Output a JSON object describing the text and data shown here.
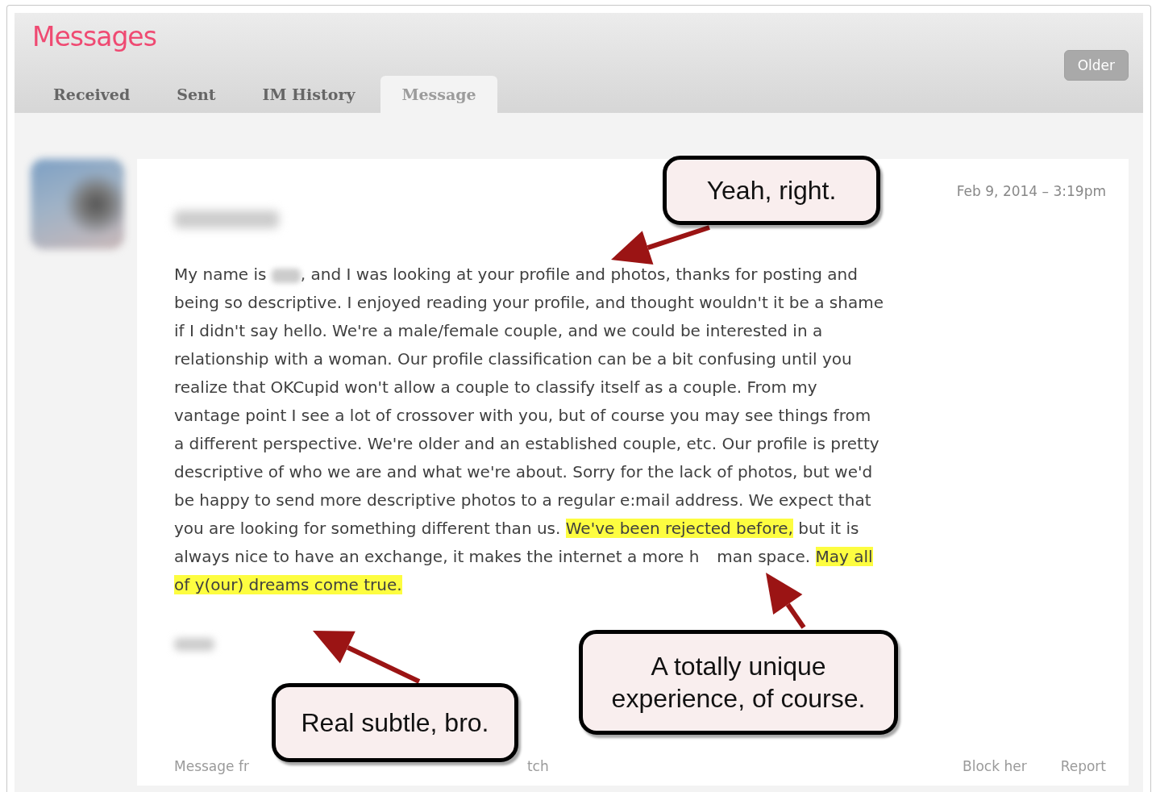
{
  "header": {
    "title": "Messages",
    "older_button": "Older"
  },
  "tabs": [
    {
      "label": "Received",
      "selected": false
    },
    {
      "label": "Sent",
      "selected": false
    },
    {
      "label": "IM History",
      "selected": false
    },
    {
      "label": "Message",
      "selected": true
    }
  ],
  "message": {
    "date": "Feb 9, 2014 – 3:19pm",
    "body": [
      {
        "kind": "text",
        "text": "My name is ",
        "highlighted": false
      },
      {
        "kind": "redacted"
      },
      {
        "kind": "text",
        "text": ", and I was looking at your profile and photos, thanks for posting and being so descriptive. I enjoyed reading your profile, and thought wouldn't it be a shame if I didn't say hello. We're a male/female couple, and we could be interested in a relationship with a woman. Our profile classification can be a bit confusing until you realize that OKCupid won't allow a couple to classify itself as a couple. From my vantage point I see a lot of crossover with you, but of course you may see things from a different perspective. We're older and an established couple, etc. Our profile is pretty descriptive of who we are and what we're about. Sorry for the lack of photos, but we'd be happy to send more descriptive photos to a regular e:mail address. We expect that you are looking for something different than us. ",
        "highlighted": false
      },
      {
        "kind": "text",
        "text": "We've been rejected before,",
        "highlighted": true
      },
      {
        "kind": "text",
        "text": " but it is always nice to have an exchange, it makes the internet a more h",
        "highlighted": false
      },
      {
        "kind": "gap"
      },
      {
        "kind": "text",
        "text": "man space. ",
        "highlighted": false
      },
      {
        "kind": "text",
        "text": "May all of y(our) dreams come true. ",
        "highlighted": true
      }
    ],
    "footer_left": [
      "Message fr",
      "tch"
    ],
    "actions": [
      "Block her",
      "Report"
    ]
  },
  "callouts": [
    {
      "text": "Yeah, right."
    },
    {
      "text": "A totally unique experience, of course."
    },
    {
      "text": "Real subtle, bro."
    }
  ]
}
